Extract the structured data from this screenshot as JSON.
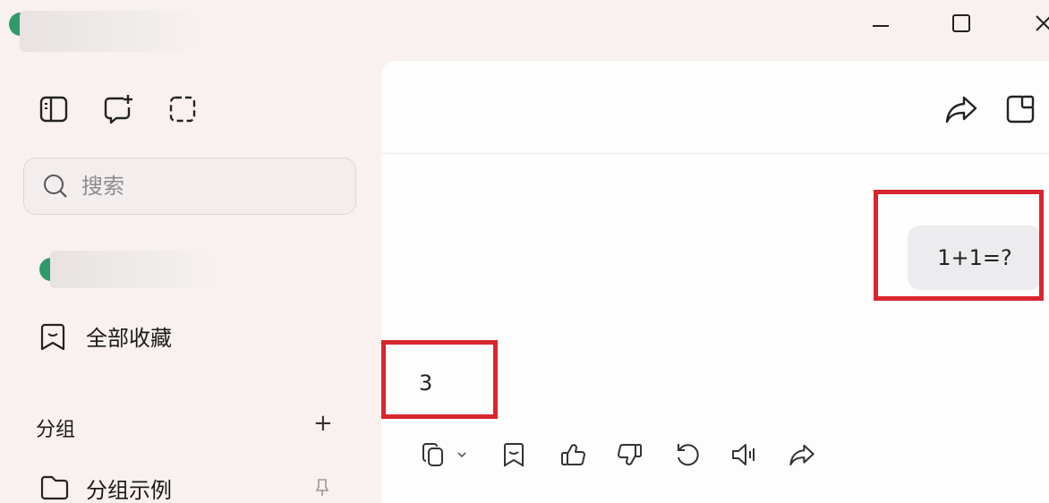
{
  "window": {
    "title_blurred": true,
    "controls": [
      "minimize-icon",
      "maximize-icon",
      "close-icon"
    ]
  },
  "sidebar": {
    "toolbar_icons": [
      "sidebar-toggle-icon",
      "new-chat-icon",
      "screenshot-icon"
    ],
    "search": {
      "placeholder": "搜索",
      "value": ""
    },
    "favorites_label": "全部收藏",
    "group_section": {
      "label": "分组",
      "add_symbol": "+"
    },
    "group_items": [
      {
        "label": "分组示例"
      }
    ]
  },
  "chat": {
    "header_icons": [
      "share-icon",
      "new-window-icon"
    ],
    "messages": [
      {
        "role": "user",
        "text": "1+1=?"
      },
      {
        "role": "assistant",
        "text": "3"
      }
    ],
    "message_actions": [
      "copy-icon",
      "copy-dropdown-icon",
      "bookmark-icon",
      "thumbs-up-icon",
      "thumbs-down-icon",
      "regenerate-icon",
      "speaker-icon",
      "share-icon"
    ],
    "highlight_color": "#d9252f"
  },
  "colors": {
    "accent_green": "#2f9b6a",
    "background": "#f8f1f0",
    "panel": "#fdfdfe"
  }
}
